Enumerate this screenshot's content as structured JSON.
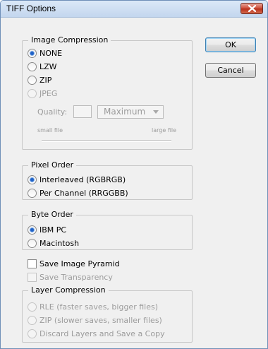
{
  "window": {
    "title": "TIFF Options"
  },
  "buttons": {
    "ok_label": "OK",
    "cancel_label": "Cancel"
  },
  "image_compression": {
    "legend": "Image Compression",
    "options": [
      {
        "label": "NONE",
        "selected": true,
        "enabled": true
      },
      {
        "label": "LZW",
        "selected": false,
        "enabled": true
      },
      {
        "label": "ZIP",
        "selected": false,
        "enabled": true
      },
      {
        "label": "JPEG",
        "selected": false,
        "enabled": false
      }
    ],
    "quality_label": "Quality:",
    "quality_value": "",
    "quality_select": "Maximum",
    "small_file_label": "small file",
    "large_file_label": "large file"
  },
  "pixel_order": {
    "legend": "Pixel Order",
    "interleaved": "Interleaved (RGBRGB)",
    "per_channel": "Per Channel (RRGGBB)",
    "selected": "Interleaved (RGBRGB)"
  },
  "byte_order": {
    "legend": "Byte Order",
    "ibm_pc": "IBM PC",
    "macintosh": "Macintosh",
    "selected": "IBM PC"
  },
  "save_image_pyramid": {
    "label": "Save Image Pyramid",
    "checked": false
  },
  "save_transparency": {
    "label": "Save Transparency",
    "checked": false,
    "enabled": false
  },
  "layer_compression": {
    "legend": "Layer Compression",
    "rle": "RLE (faster saves, bigger files)",
    "zip": "ZIP (slower saves, smaller files)",
    "discard": "Discard Layers and Save a Copy"
  }
}
